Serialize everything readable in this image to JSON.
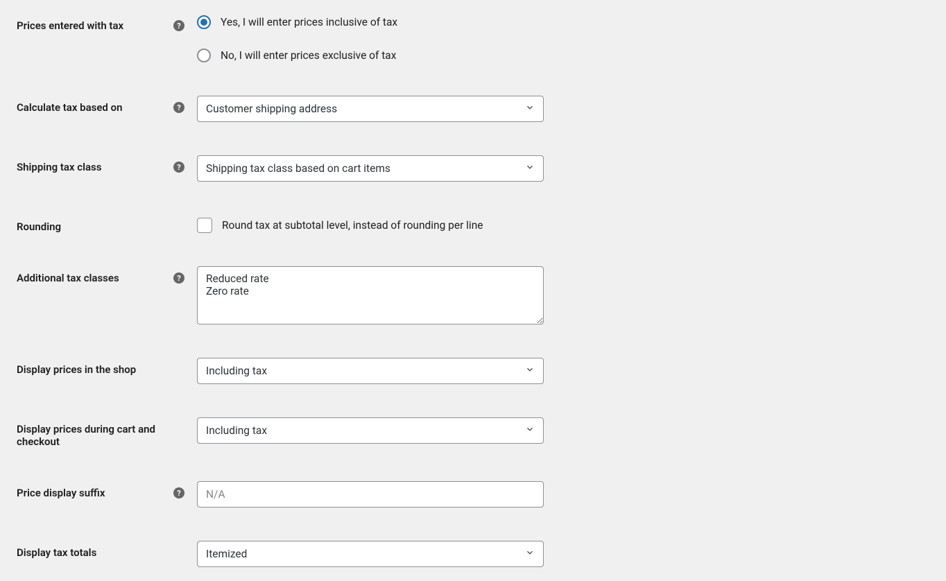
{
  "fields": {
    "prices_entered": {
      "label": "Prices entered with tax",
      "option_yes": "Yes, I will enter prices inclusive of tax",
      "option_no": "No, I will enter prices exclusive of tax"
    },
    "calculate_tax": {
      "label": "Calculate tax based on",
      "value": "Customer shipping address"
    },
    "shipping_tax_class": {
      "label": "Shipping tax class",
      "value": "Shipping tax class based on cart items"
    },
    "rounding": {
      "label": "Rounding",
      "checkbox_label": "Round tax at subtotal level, instead of rounding per line"
    },
    "additional_tax_classes": {
      "label": "Additional tax classes",
      "value": "Reduced rate\nZero rate"
    },
    "display_shop": {
      "label": "Display prices in the shop",
      "value": "Including tax"
    },
    "display_cart": {
      "label": "Display prices during cart and checkout",
      "value": "Including tax"
    },
    "price_suffix": {
      "label": "Price display suffix",
      "placeholder": "N/A",
      "value": ""
    },
    "display_tax_totals": {
      "label": "Display tax totals",
      "value": "Itemized"
    }
  }
}
